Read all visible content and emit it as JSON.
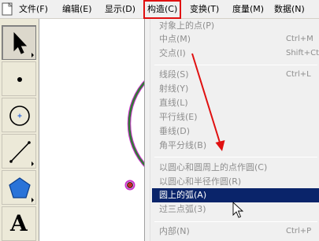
{
  "menubar": {
    "items": [
      {
        "label": "文件(F)"
      },
      {
        "label": "编辑(E)"
      },
      {
        "label": "显示(D)"
      },
      {
        "label": "构造(C)"
      },
      {
        "label": "变换(T)"
      },
      {
        "label": "度量(M)"
      },
      {
        "label": "数据(N)"
      }
    ]
  },
  "toolbox": {
    "tools": [
      {
        "name": "select-arrow-tool",
        "icon": "arrow-pointer-icon",
        "selected": true
      },
      {
        "name": "point-tool",
        "icon": "point-icon"
      },
      {
        "name": "compass-tool",
        "icon": "circle-icon"
      },
      {
        "name": "straightedge-tool",
        "icon": "segment-icon"
      },
      {
        "name": "polygon-tool",
        "icon": "pentagon-icon"
      },
      {
        "name": "text-tool",
        "icon": "text-A-icon",
        "label": "A"
      }
    ]
  },
  "construct_menu": {
    "items": [
      {
        "label": "对象上的点(P)",
        "shortcut": ""
      },
      {
        "label": "中点(M)",
        "shortcut": "Ctrl+M"
      },
      {
        "label": "交点(I)",
        "shortcut": "Shift+Ct"
      },
      {
        "label": "线段(S)",
        "shortcut": "Ctrl+L"
      },
      {
        "label": "射线(Y)",
        "shortcut": ""
      },
      {
        "label": "直线(L)",
        "shortcut": ""
      },
      {
        "label": "平行线(E)",
        "shortcut": ""
      },
      {
        "label": "垂线(D)",
        "shortcut": ""
      },
      {
        "label": "角平分线(B)",
        "shortcut": ""
      },
      {
        "label": "以圆心和圆周上的点作圆(C)",
        "shortcut": ""
      },
      {
        "label": "以圆心和半径作圆(R)",
        "shortcut": ""
      },
      {
        "label": "圆上的弧(A)",
        "shortcut": ""
      },
      {
        "label": "过三点弧(3)",
        "shortcut": ""
      },
      {
        "label": "内部(N)",
        "shortcut": "Ctrl+P"
      }
    ]
  },
  "colors": {
    "highlight": "#0a246a",
    "annotation_red": "#e01010",
    "circle_green": "#2e7d32",
    "circle_magenta": "#cc33cc"
  }
}
